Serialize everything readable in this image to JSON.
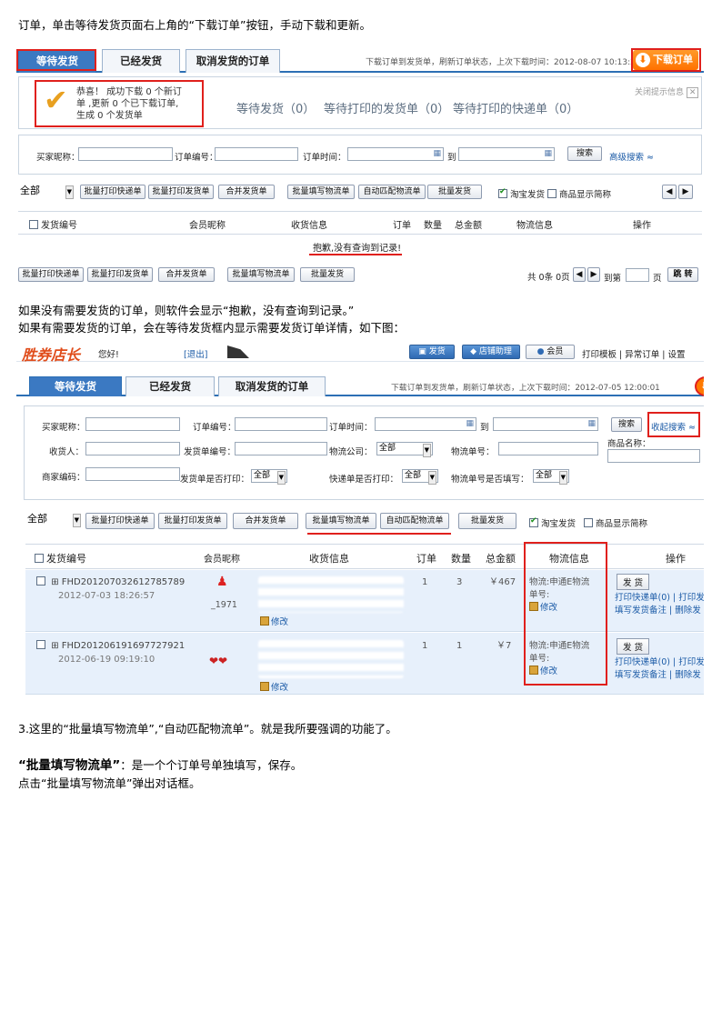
{
  "doc": {
    "intro_line": "订单，单击等待发货页面右上角的“下载订单”按钮，手动下载和更新。",
    "para1_line1": "如果没有需要发货的订单，则软件会显示“抱歉，没有查询到记录。”",
    "para1_line2": "如果有需要发货的订单，会在等待发货框内显示需要发货订单详情，如下图：",
    "para2": "3.这里的“批量填写物流单”,“自动匹配物流单”。就是我所要强调的功能了。",
    "para3_bold": "“批量填写物流单”",
    "para3_rest": "：是一个个订单号单独填写，保存。",
    "para4": "点击“批量填写物流单”弹出对话框。"
  },
  "shot1": {
    "tabs": [
      "等待发货",
      "已经发货",
      "取消发货的订单"
    ],
    "hint": "下载订单到发货单，刷新订单状态，上次下载时间：2012-08-07 10:13:22",
    "download_btn": "下载订单",
    "success_line1": "恭喜！ 成功下载 0 个新订",
    "success_line2": "单 ,更新 0 个已下载订单,",
    "success_line3": "生成 0 个发货单",
    "close_tip": "关闭提示信息",
    "status_waiting": "等待发货（0）",
    "status_print_ship": "等待打印的发货单（0）",
    "status_print_express": "等待打印的快递单（0）",
    "label_buyer": "买家昵称：",
    "label_order_no": "订单编号：",
    "label_order_time": "订单时间：",
    "label_to": "到",
    "search_btn": "搜索",
    "adv_search": "高级搜索",
    "filter_all": "全部",
    "toolbar": [
      "批量打印快递单",
      "批量打印发货单",
      "合并发货单",
      "批量填写物流单",
      "自动匹配物流单",
      "批量发货"
    ],
    "check_taobao": "淘宝发货",
    "check_brief": "商品显示简称",
    "headers": [
      "发货编号",
      "会员昵称",
      "收货信息",
      "订单",
      "数量",
      "总金额",
      "物流信息",
      "操作"
    ],
    "empty_msg": "抱歉,没有查询到记录!",
    "bottom_toolbar": [
      "批量打印快递单",
      "批量打印发货单",
      "合并发货单",
      "批量填写物流单",
      "批量发货"
    ],
    "pager": "共 0条 0页",
    "pager_goto": "到第",
    "pager_page": "页",
    "pager_jump": "跳 转"
  },
  "shot2": {
    "logo": "胜券店长",
    "greeting": "您好!",
    "logout": "[退出]",
    "nav": [
      "发货",
      "店铺助理",
      "会员",
      "打印模板",
      "异常订单",
      "设置"
    ],
    "tabs": [
      "等待发货",
      "已经发货",
      "取消发货的订单"
    ],
    "hint": "下载订单到发货单，刷新订单状态，上次下载时间：2012-07-05 12:00:01",
    "label_buyer": "买家昵称：",
    "label_order_no": "订单编号：",
    "label_order_time": "订单时间：",
    "label_to": "到",
    "search_btn": "搜索",
    "collapse_search": "收起搜索",
    "label_product": "商品名称：",
    "label_receiver": "收货人：",
    "label_ship_no": "发货单编号：",
    "label_logistics_co": "物流公司：",
    "logistics_co_val": "全部",
    "label_logistics_no": "物流单号：",
    "label_merchant_code": "商家编码：",
    "label_ship_printed": "发货单是否打印：",
    "ship_printed_val": "全部",
    "label_express_printed": "快递单是否打印：",
    "express_printed_val": "全部",
    "label_logistics_filled": "物流单号是否填写：",
    "logistics_filled_val": "全部",
    "filter_all": "全部",
    "toolbar": [
      "批量打印快递单",
      "批量打印发货单",
      "合并发货单",
      "批量填写物流单",
      "自动匹配物流单",
      "批量发货"
    ],
    "check_taobao": "淘宝发货",
    "check_brief": "商品显示简称",
    "headers": [
      "发货编号",
      "会员昵称",
      "收货信息",
      "订单",
      "数量",
      "总金额",
      "物流信息",
      "操作"
    ],
    "rows": [
      {
        "id": "FHD201207032612785789",
        "date": "2012-07-03 18:26:57",
        "member": "_1971",
        "orders": "1",
        "qty": "3",
        "amount": "￥467",
        "logistics_co": "物流:申通E物流",
        "logistics_no": "单号:",
        "edit": "修改",
        "ship": "发 货",
        "ops1": "打印快递单(0) | 打印发",
        "ops2": "填写发货备注 | 删除发"
      },
      {
        "id": "FHD201206191697727921",
        "date": "2012-06-19 09:19:10",
        "member": "",
        "orders": "1",
        "qty": "1",
        "amount": "￥7",
        "logistics_co": "物流:申通E物流",
        "logistics_no": "单号:",
        "edit": "修改",
        "ship": "发 货",
        "ops1": "打印快递单(0) | 打印发",
        "ops2": "填写发货备注 | 删除发"
      }
    ]
  },
  "colors": {
    "accent": "#3b79c2",
    "orange": "#ff7a00",
    "red": "#e0201c",
    "row_bg": "#e7f0fb"
  }
}
